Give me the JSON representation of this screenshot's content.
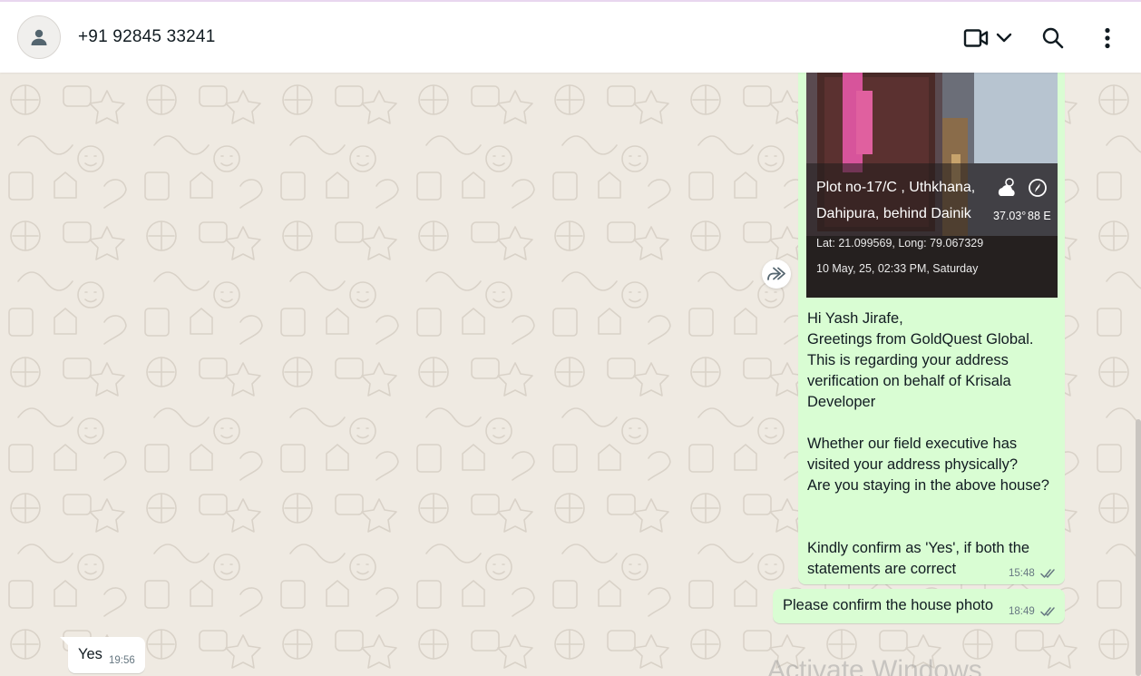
{
  "header": {
    "contact": "+91 92845 33241",
    "icons": [
      "person-icon",
      "video-call-icon",
      "chevron-down-icon",
      "search-icon",
      "more-vertical-icon"
    ]
  },
  "photo": {
    "address_line1": "Plot no-17/C , Uthkhana,",
    "address_line2": "Dahipura, behind Dainik",
    "coords": "Lat: 21.099569, Long: 79.067329",
    "datetime": "10 May, 25, 02:33 PM, Saturday",
    "temperature": "37.03°",
    "direction": "88 E"
  },
  "messages": {
    "m1": {
      "text": "Hi Yash Jirafe,\nGreetings from GoldQuest Global.\nThis is regarding your address\nverification on behalf of Krisala\nDeveloper\n\nWhether our field executive has\nvisited your address physically?\nAre you staying in the above house?\n\n\nKindly confirm as 'Yes', if both the\nstatements are correct",
      "time": "15:48"
    },
    "m2": {
      "text": "Please confirm the house photo",
      "time": "18:49"
    },
    "m3": {
      "text": "Yes",
      "time": "19:56"
    }
  },
  "watermark": "Activate Windows",
  "colors": {
    "outgoing": "#d9fdd3",
    "incoming": "#ffffff",
    "background": "#efeae2",
    "tick": "#667781"
  }
}
